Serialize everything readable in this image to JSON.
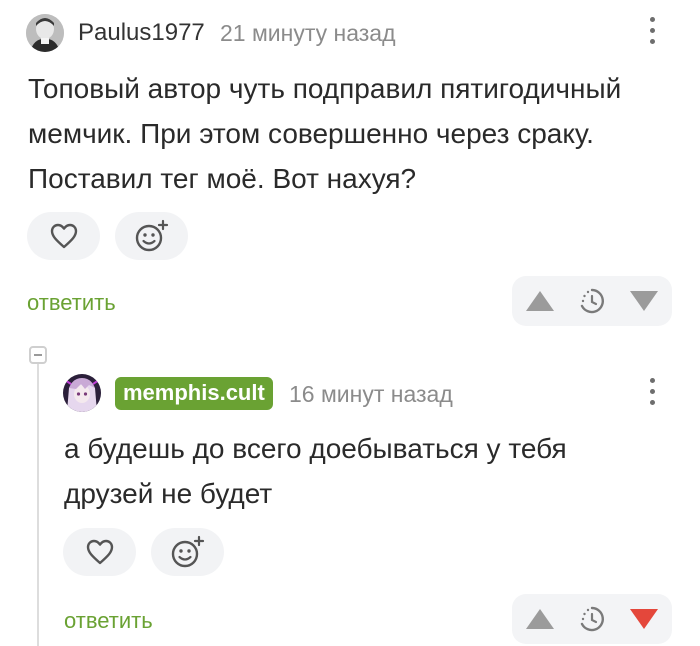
{
  "comments": [
    {
      "author": "Paulus1977",
      "time": "21 минуту назад",
      "text_lines": [
        "Топовый автор чуть подправил пятигодичный",
        "мемчик. При этом совершенно через сраку.",
        "Поставил тег моё. Вот нахуя?"
      ],
      "reply_label": "ответить",
      "vote_state": "none"
    },
    {
      "author": "memphis.cult",
      "time": "16 минут назад",
      "text_lines": [
        "а будешь до всего доебываться у тебя",
        "друзей не будет"
      ],
      "reply_label": "ответить",
      "vote_state": "down"
    }
  ],
  "icons": {
    "like": "heart-icon",
    "react": "smile-plus-icon",
    "upvote": "triangle-up-icon",
    "rating": "clock-icon",
    "downvote": "triangle-down-icon",
    "menu": "kebab-icon",
    "collapse": "minus-square-icon"
  },
  "colors": {
    "accent_green": "#6aa233",
    "vote_gray": "#9b9b9b",
    "vote_down_active": "#e4473b",
    "button_bg": "#f2f3f5"
  }
}
